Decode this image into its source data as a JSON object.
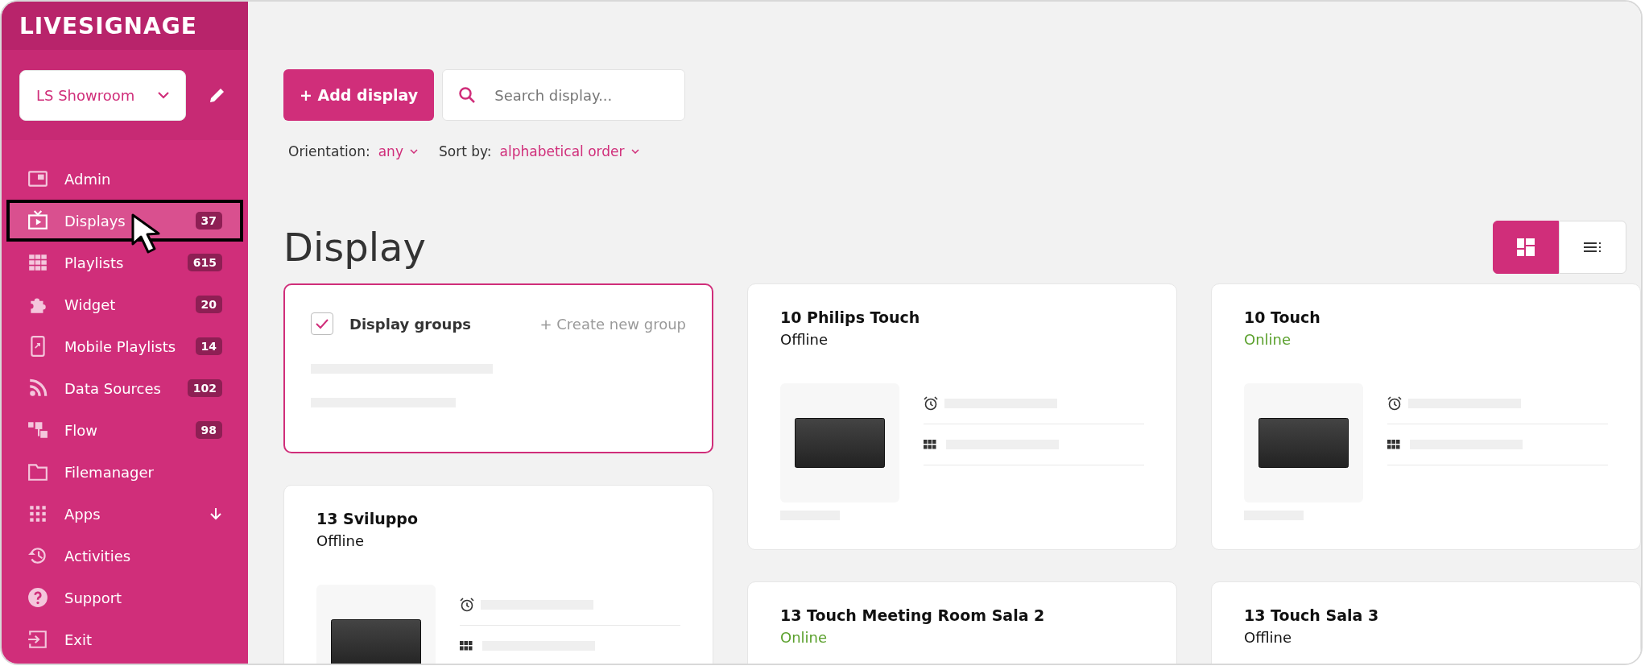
{
  "brand": {
    "logo": "LIVESIGNAGE"
  },
  "workspace": {
    "value": "LS Showroom"
  },
  "nav": [
    {
      "label": "Admin",
      "kind": "link",
      "selected": false
    },
    {
      "label": "Displays",
      "kind": "link",
      "badge": "37",
      "selected": true
    },
    {
      "label": "Playlists",
      "kind": "link",
      "badge": "615",
      "selected": false
    },
    {
      "label": "Widget",
      "kind": "link",
      "badge": "20",
      "selected": false
    },
    {
      "label": "Mobile Playlists",
      "kind": "link",
      "badge": "14",
      "selected": false
    },
    {
      "label": "Data Sources",
      "kind": "link",
      "badge": "102",
      "selected": false
    },
    {
      "label": "Flow",
      "kind": "link",
      "badge": "98",
      "selected": false
    },
    {
      "label": "Filemanager",
      "kind": "link",
      "selected": false
    },
    {
      "label": "Apps",
      "kind": "submenu",
      "selected": false
    },
    {
      "label": "Activities",
      "kind": "link",
      "selected": false
    },
    {
      "label": "Support",
      "kind": "link",
      "selected": false
    },
    {
      "label": "Exit",
      "kind": "link",
      "selected": false
    }
  ],
  "toolbar": {
    "add_button": "+ Add display",
    "search": {
      "placeholder": "Search display..."
    }
  },
  "filters": [
    {
      "label": "Orientation:",
      "value": "any"
    },
    {
      "label": "Sort by:",
      "value": "alphabetical order"
    }
  ],
  "heading": "Display",
  "view_toggle": [
    {
      "selected": true
    },
    {
      "selected": false
    }
  ],
  "group_card": {
    "checked": true,
    "title": "Display groups",
    "action": "+ Create new group"
  },
  "devices": [
    {
      "name": "10 Philips Touch",
      "status": "Offline",
      "online": false
    },
    {
      "name": "10 Touch",
      "status": "Online",
      "online": true
    },
    {
      "name": "13 Sviluppo",
      "status": "Offline",
      "online": false
    },
    {
      "name": "13 Touch Meeting Room Sala 2",
      "status": "Online",
      "online": true
    },
    {
      "name": "13 Touch Sala 3",
      "status": "Offline",
      "online": false
    }
  ]
}
